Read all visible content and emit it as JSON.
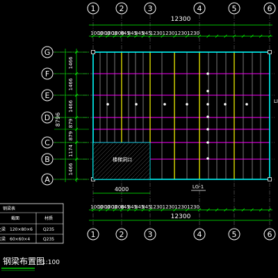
{
  "drawing": {
    "title": "钢梁布置图",
    "scale": "1:100",
    "axis_numbers": [
      "1",
      "2",
      "3",
      "4",
      "5",
      "6"
    ],
    "axis_letters": [
      "A",
      "B",
      "C",
      "D",
      "E",
      "F",
      "G"
    ],
    "overall_width": "12300",
    "overall_height": "8796",
    "top_dims": [
      "1000",
      "1000",
      "1000",
      "1000",
      "845",
      "845",
      "845",
      "845",
      "1230",
      "1230",
      "1230",
      "1230"
    ],
    "bottom_dims": [
      "1000",
      "1000",
      "1000",
      "1000",
      "845",
      "845",
      "845",
      "845",
      "1230",
      "1230",
      "1230",
      "1230"
    ],
    "left_dims": [
      "1466",
      "1466",
      "1466",
      "879",
      "879",
      "1174",
      "1466"
    ],
    "bottom_label_4000": "4000",
    "opening_label": "楼梯洞口",
    "beam_tag": "LG-1",
    "right_tag": "LI",
    "colors": {
      "background": "#000000",
      "frame": "#00ffff",
      "axis_bubble": "#ffffff",
      "yellow_beam": "#ffff00",
      "magenta_beam": "#ff00ff",
      "gray_beam": "#9a9a9a",
      "dim_green": "#00ff00",
      "text": "#ffffff",
      "title_underline": "#00ff00"
    }
  },
  "legend": {
    "header": "钢梁表",
    "col_section": "截面",
    "col_material": "材质",
    "rows": [
      {
        "name": "主梁",
        "section": "120×80×6",
        "material": "Q235"
      },
      {
        "name": "次梁",
        "section": "60×60×4",
        "material": "Q235"
      }
    ]
  }
}
